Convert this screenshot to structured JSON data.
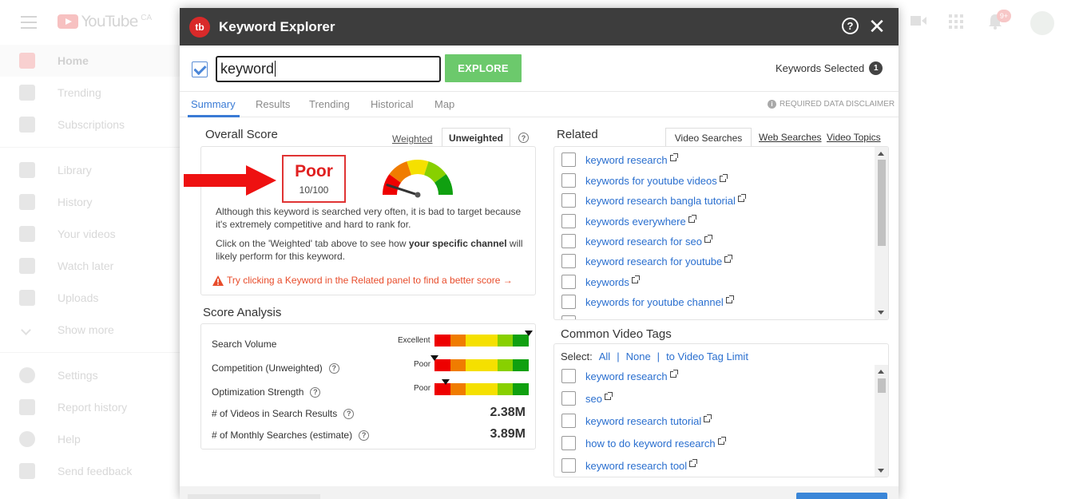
{
  "youtube": {
    "logo_text": "YouTube",
    "region": "CA",
    "notifications": "9+",
    "sidebar": [
      {
        "label": "Home",
        "icon": "home-icon",
        "active": true
      },
      {
        "label": "Trending",
        "icon": "flame-icon"
      },
      {
        "label": "Subscriptions",
        "icon": "subscriptions-icon"
      },
      {
        "label": "Library",
        "icon": "library-icon"
      },
      {
        "label": "History",
        "icon": "history-icon"
      },
      {
        "label": "Your videos",
        "icon": "play-square-icon"
      },
      {
        "label": "Watch later",
        "icon": "clock-icon"
      },
      {
        "label": "Uploads",
        "icon": "list-icon"
      },
      {
        "label": "Show more",
        "icon": "chevron-down-icon"
      },
      {
        "label": "Settings",
        "icon": "gear-icon"
      },
      {
        "label": "Report history",
        "icon": "flag-icon"
      },
      {
        "label": "Help",
        "icon": "help-icon"
      },
      {
        "label": "Send feedback",
        "icon": "feedback-icon"
      }
    ]
  },
  "modal": {
    "logo": "tb",
    "title": "Keyword Explorer",
    "search": {
      "value": "keyword",
      "explore_label": "EXPLORE"
    },
    "keywords_selected": {
      "label": "Keywords Selected",
      "count": "1"
    },
    "tabs": [
      "Summary",
      "Results",
      "Trending",
      "Historical",
      "Map"
    ],
    "active_tab": "Summary",
    "disclaimer": "REQUIRED DATA DISCLAIMER",
    "overall": {
      "title": "Overall Score",
      "weighted": "Weighted",
      "unweighted": "Unweighted",
      "score_word": "Poor",
      "score_num": "10/100",
      "gauge_level": 0.1,
      "text1": "Although this keyword is searched very often, it is bad to target because it's extremely competitive and hard to rank for.",
      "text2_a": "Click on the 'Weighted' tab above to see how ",
      "text2_b": "your specific channel",
      "text2_c": " will likely perform for this keyword.",
      "warning": "Try clicking a Keyword in the Related panel to find a better score →"
    },
    "analysis": {
      "title": "Score Analysis",
      "rows": [
        {
          "label": "Search Volume",
          "rating": "Excellent",
          "level": 1.0
        },
        {
          "label": "Competition (Unweighted)",
          "rating": "Poor",
          "level": 0.0
        },
        {
          "label": "Optimization Strength",
          "rating": "Poor",
          "level": 0.12
        },
        {
          "label": "# of Videos in Search Results",
          "value": "2.38M"
        },
        {
          "label": "# of Monthly Searches (estimate)",
          "value": "3.89M"
        }
      ],
      "meter_colors": [
        "#ee0000",
        "#f07c00",
        "#f5e000",
        "#f5e000",
        "#88d000",
        "#10a010"
      ]
    },
    "related": {
      "title": "Related",
      "tabs": [
        "Video Searches",
        "Web Searches",
        "Video Topics"
      ],
      "items": [
        "keyword research",
        "keywords for youtube videos",
        "keyword research bangla tutorial",
        "keywords everywhere",
        "keyword research for seo",
        "keyword research for youtube",
        "keywords",
        "keywords for youtube channel"
      ]
    },
    "tags": {
      "title": "Common Video Tags",
      "select_label": "Select:",
      "all": "All",
      "none": "None",
      "limit": "to Video Tag Limit",
      "items": [
        "keyword research",
        "seo",
        "keyword research tutorial",
        "how to do keyword research",
        "keyword research tool"
      ]
    }
  }
}
